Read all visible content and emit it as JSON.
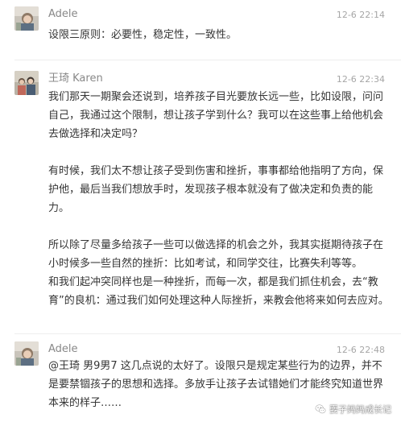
{
  "comments": [
    {
      "author": "Adele",
      "time": "12-6 22:14",
      "avatar_icon": "child-photo-avatar",
      "paragraphs": [
        "设限三原则：必要性，稳定性，一致性。"
      ]
    },
    {
      "author": "王琦 Karen",
      "time": "12-6 22:34",
      "avatar_icon": "family-photo-avatar",
      "paragraphs": [
        "我们那天一期聚会还说到，培养孩子目光要放长远一些，比如设限，问问自己，我通过这个限制，想让孩子学到什么？我可以在这些事上给他机会去做选择和决定吗？",
        "有时候，我们太不想让孩子受到伤害和挫折，事事都给他指明了方向，保护他，最后当我们想放手时，发现孩子根本就没有了做决定和负责的能力。",
        "所以除了尽量多给孩子一些可以做选择的机会之外，我其实挺期待孩子在小时候多一些自然的挫折：比如考试，和同学交往，比赛失利等等。",
        "和我们起冲突同样也是一种挫折，而每一次，都是我们抓住机会，去“教育”的良机：通过我们如何处理这种人际挫折，来教会他将来如何去应对。"
      ]
    },
    {
      "author": "Adele",
      "time": "12-6 22:48",
      "avatar_icon": "child-photo-avatar",
      "paragraphs": [
        "@王琦 男9男7 这几点说的太好了。设限只是规定某些行为的边界，并不是要禁锢孩子的思想和选择。多放手让孩子去试错她们才能终究知道世界本来的样子……"
      ]
    }
  ],
  "watermark": {
    "label": "耍子妈妈成长记",
    "icon": "wechat-bubble-icon"
  },
  "colors": {
    "author": "#888888",
    "time": "#a6a6a6",
    "body_text": "#353535",
    "divider": "#eeeeee"
  }
}
